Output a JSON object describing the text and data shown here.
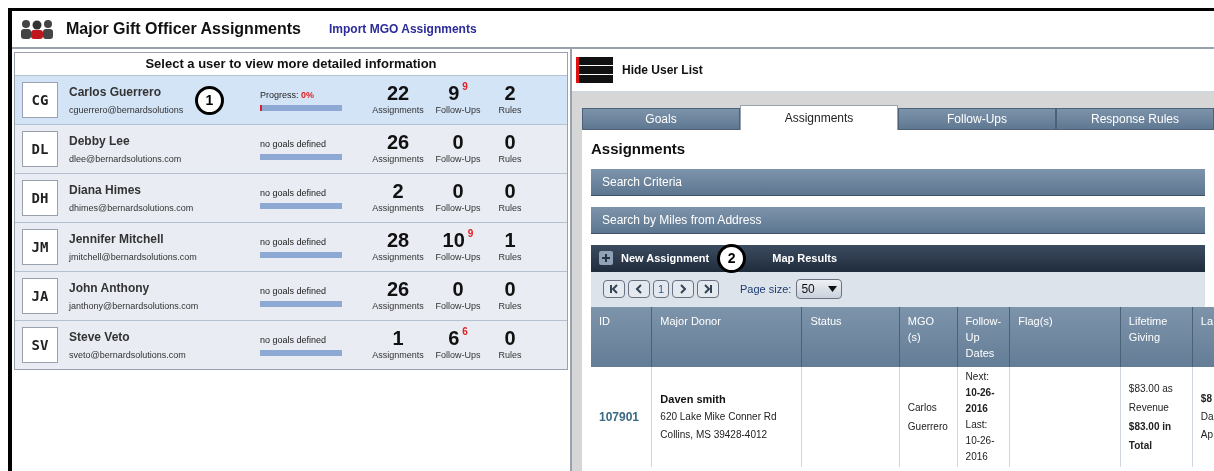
{
  "header": {
    "title": "Major Gift Officer Assignments",
    "import_link": "Import MGO Assignments"
  },
  "user_list": {
    "heading": "Select a user to view more detailed information",
    "users": [
      {
        "initials": "CG",
        "name": "Carlos Guerrero",
        "email": "cguerrero@bernardsolutions",
        "selected": true,
        "goal": {
          "kind": "progress",
          "label": "Progress:",
          "value": "0%",
          "level": 0.03
        },
        "assignments": "22",
        "assignments_label": "Assignments",
        "follow_ups": "9",
        "follow_ups_badge": "9",
        "follow_ups_label": "Follow-Ups",
        "rules": "2",
        "rules_label": "Rules"
      },
      {
        "initials": "DL",
        "name": "Debby Lee",
        "email": "dlee@bernardsolutions.com",
        "selected": false,
        "goal": {
          "kind": "none",
          "label": "no goals defined"
        },
        "assignments": "26",
        "assignments_label": "Assignments",
        "follow_ups": "0",
        "follow_ups_label": "Follow-Ups",
        "rules": "0",
        "rules_label": "Rules"
      },
      {
        "initials": "DH",
        "name": "Diana Himes",
        "email": "dhimes@bernardsolutions.com",
        "selected": false,
        "goal": {
          "kind": "none",
          "label": "no goals defined"
        },
        "assignments": "2",
        "assignments_label": "Assignments",
        "follow_ups": "0",
        "follow_ups_label": "Follow-Ups",
        "rules": "0",
        "rules_label": "Rules"
      },
      {
        "initials": "JM",
        "name": "Jennifer Mitchell",
        "email": "jmitchell@bernardsolutions.com",
        "selected": false,
        "goal": {
          "kind": "none",
          "label": "no goals defined"
        },
        "assignments": "28",
        "assignments_label": "Assignments",
        "follow_ups": "10",
        "follow_ups_badge": "9",
        "follow_ups_label": "Follow-Ups",
        "rules": "1",
        "rules_label": "Rules"
      },
      {
        "initials": "JA",
        "name": "John Anthony",
        "email": "janthony@bernardsolutions.com",
        "selected": false,
        "goal": {
          "kind": "none",
          "label": "no goals defined"
        },
        "assignments": "26",
        "assignments_label": "Assignments",
        "follow_ups": "0",
        "follow_ups_label": "Follow-Ups",
        "rules": "0",
        "rules_label": "Rules"
      },
      {
        "initials": "SV",
        "name": "Steve Veto",
        "email": "sveto@bernardsolutions.com",
        "selected": false,
        "goal": {
          "kind": "none",
          "label": "no goals defined"
        },
        "assignments": "1",
        "assignments_label": "Assignments",
        "follow_ups": "6",
        "follow_ups_badge": "6",
        "follow_ups_label": "Follow-Ups",
        "rules": "0",
        "rules_label": "Rules"
      }
    ]
  },
  "callouts": [
    "1",
    "2"
  ],
  "detail": {
    "hide_button": "Hide User List",
    "tabs": [
      {
        "label": "Goals",
        "selected": false
      },
      {
        "label": "Assignments",
        "selected": true
      },
      {
        "label": "Follow-Ups",
        "selected": false
      },
      {
        "label": "Response Rules",
        "selected": false
      }
    ],
    "section_title": "Assignments",
    "panels": [
      "Search Criteria",
      "Search by Miles from Address"
    ],
    "toolbar": {
      "new_button": "New Assignment",
      "map_button": "Map Results"
    },
    "pager": {
      "page": "1",
      "page_size_label": "Page size:",
      "page_size": "50"
    },
    "table": {
      "columns": [
        "ID",
        "Major Donor",
        "Status",
        "MGO (s)",
        "Follow-Up Dates",
        "Flag(s)",
        "Lifetime Giving",
        "La"
      ],
      "rows": [
        {
          "id": "107901",
          "donor_name": "Daven smith",
          "address_1": "620 Lake Mike Conner Rd",
          "address_2": "Collins, MS 39428-4012",
          "status": "",
          "mgo": "Carlos Guerrero",
          "follow_up": "Next: **10-26-2016** Last: 10-26-2016",
          "lifetime": "$83.00 as Revenue **$83.00 in Total**",
          "column_8": [
            "$8",
            "Da",
            "Ap"
          ]
        }
      ]
    }
  }
}
